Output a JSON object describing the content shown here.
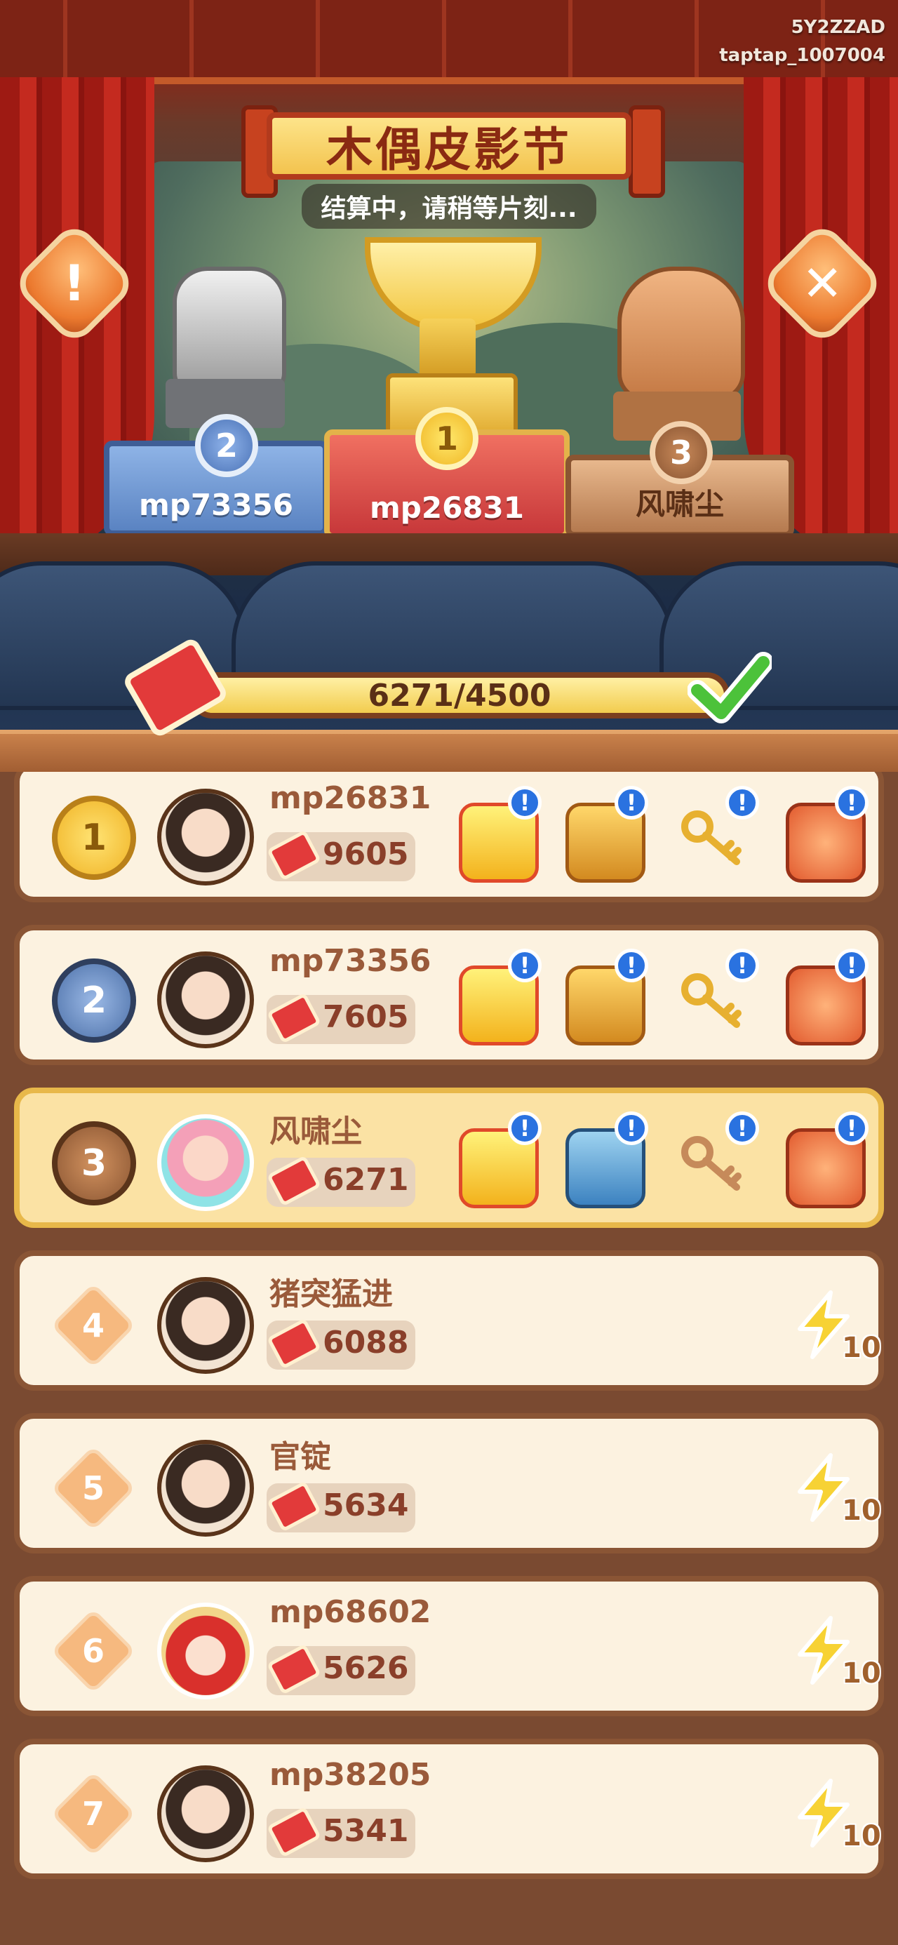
{
  "watermark": {
    "line1": "5Y2ZZAD",
    "line2": "taptap_1007004"
  },
  "event": {
    "title": "木偶皮影节",
    "subtitle": "结算中，请稍等片刻..."
  },
  "podium": [
    {
      "rank": "2",
      "name": "mp73356",
      "trophy_icon": "silver-fist-trophy"
    },
    {
      "rank": "1",
      "name": "mp26831",
      "trophy_icon": "gold-cup-trophy"
    },
    {
      "rank": "3",
      "name": "风啸尘",
      "trophy_icon": "bronze-hand-trophy"
    }
  ],
  "progress": {
    "text": "6271/4500",
    "fill_fraction": 1.0,
    "completed": true
  },
  "ranking": [
    {
      "rank": "1",
      "name": "mp26831",
      "score": "9605",
      "rewards": [
        "energy-bucket",
        "golden-chest",
        "golden-key",
        "jade-pouch"
      ],
      "reward_alert": "!"
    },
    {
      "rank": "2",
      "name": "mp73356",
      "score": "7605",
      "rewards": [
        "energy-bucket",
        "golden-chest",
        "golden-key",
        "jade-pouch"
      ],
      "reward_alert": "!"
    },
    {
      "rank": "3",
      "name": "风啸尘",
      "score": "6271",
      "rewards": [
        "energy-bucket",
        "blue-chest",
        "silver-key",
        "orange-pouch"
      ],
      "reward_alert": "!",
      "highlight": true
    },
    {
      "rank": "4",
      "name": "猪突猛进",
      "score": "6088",
      "reward_count": "10"
    },
    {
      "rank": "5",
      "name": "官锭",
      "score": "5634",
      "reward_count": "10"
    },
    {
      "rank": "6",
      "name": "mp68602",
      "score": "5626",
      "reward_count": "10"
    },
    {
      "rank": "7",
      "name": "mp38205",
      "score": "5341",
      "reward_count": "10"
    }
  ],
  "colors": {
    "list_bg": "#7a4a31",
    "row_bg": "#fcf2e0",
    "row_highlight": "#fbe2a4",
    "alert_blue": "#2a72e0"
  }
}
